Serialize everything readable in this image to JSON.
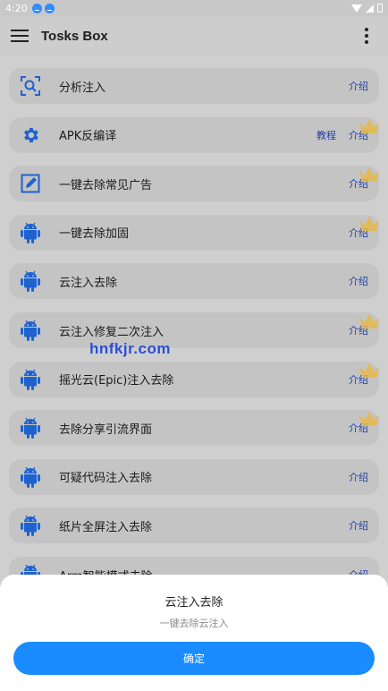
{
  "status_bar": {
    "time": "4:20"
  },
  "app_bar": {
    "title": "Tosks Box"
  },
  "list": {
    "items": [
      {
        "label": "分析注入",
        "icon": "scan-icon",
        "links": [
          "介绍"
        ],
        "crown": false
      },
      {
        "label": "APK反编译",
        "icon": "gear-icon",
        "links": [
          "教程",
          "介绍"
        ],
        "crown": true
      },
      {
        "label": "一键去除常见广告",
        "icon": "edit-icon",
        "links": [
          "介绍"
        ],
        "crown": true
      },
      {
        "label": "一键去除加固",
        "icon": "android-icon",
        "links": [
          "介绍"
        ],
        "crown": true
      },
      {
        "label": "云注入去除",
        "icon": "android-icon",
        "links": [
          "介绍"
        ],
        "crown": false
      },
      {
        "label": "云注入修复二次注入",
        "icon": "android-icon",
        "links": [
          "介绍"
        ],
        "crown": true
      },
      {
        "label": "摇光云(Epic)注入去除",
        "icon": "android-icon",
        "links": [
          "介绍"
        ],
        "crown": true
      },
      {
        "label": "去除分享引流界面",
        "icon": "android-icon",
        "links": [
          "介绍"
        ],
        "crown": true
      },
      {
        "label": "可疑代码注入去除",
        "icon": "android-icon",
        "links": [
          "介绍"
        ],
        "crown": false
      },
      {
        "label": "纸片全屏注入去除",
        "icon": "android-icon",
        "links": [
          "介绍"
        ],
        "crown": false
      },
      {
        "label": "Arm智能模式去除",
        "icon": "android-icon",
        "links": [
          "介绍"
        ],
        "crown": false
      }
    ]
  },
  "watermark": "hnfkjr.com",
  "sheet": {
    "title": "云注入去除",
    "subtitle": "一键去除云注入",
    "confirm_label": "确定"
  },
  "colors": {
    "accent": "#1a8cff",
    "icon_blue": "#1e62d0",
    "link": "#1c3fa8",
    "crown": "#e6b94a"
  }
}
